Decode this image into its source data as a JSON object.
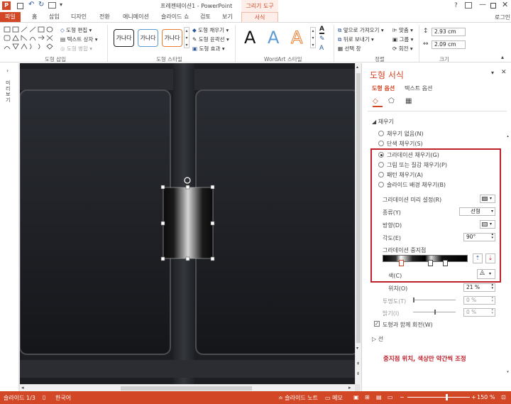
{
  "titlebar": {
    "title": "프레젠테이션1 - PowerPoint",
    "context_tool": "그리기 도구",
    "help": "?",
    "login": "로그인"
  },
  "tabs": [
    "파일",
    "홈",
    "삽입",
    "디자인",
    "전환",
    "애니메이션",
    "슬라이드 쇼",
    "검토",
    "보기",
    "서식"
  ],
  "ribbon": {
    "insert_shapes": {
      "edit": "도형 편집",
      "textbox": "텍스트 상자",
      "merge": "도형 병합",
      "label": "도형 삽입"
    },
    "shape_styles": {
      "samples": [
        "가나다",
        "가나다",
        "가나다"
      ],
      "fill": "도형 채우기",
      "outline": "도형 윤곽선",
      "effects": "도형 효과",
      "label": "도형 스타일"
    },
    "wordart": {
      "letters": [
        "A",
        "A",
        "A"
      ],
      "label": "WordArt 스타일"
    },
    "arrange": {
      "forward": "앞으로 가져오기",
      "backward": "뒤로 보내기",
      "selection": "선택 창",
      "align": "맞춤",
      "group": "그룹",
      "rotate": "회전",
      "label": "정렬"
    },
    "size": {
      "height": "2.93 cm",
      "width": "2.09 cm",
      "label": "크기"
    }
  },
  "left_strip": {
    "label": "미리보기"
  },
  "pane": {
    "title": "도형 서식",
    "tab_shape": "도형 옵션",
    "tab_text": "텍스트 옵션",
    "fill_section": "채우기",
    "fill_options": [
      {
        "label": "채우기 없음(N)",
        "checked": false
      },
      {
        "label": "단색 채우기(S)",
        "checked": false
      },
      {
        "label": "그라데이션 채우기(G)",
        "checked": true
      },
      {
        "label": "그림 또는 질감 채우기(P)",
        "checked": false
      },
      {
        "label": "패턴 채우기(A)",
        "checked": false
      },
      {
        "label": "슬라이드 배경 채우기(B)",
        "checked": false
      }
    ],
    "preset_label": "그라데이션 미리 설정(R)",
    "type_label": "종류(Y)",
    "type_value": "선형",
    "direction_label": "방향(D)",
    "angle_label": "각도(E)",
    "angle_value": "90°",
    "stops_label": "그라데이션 중지점",
    "color_label": "색(C)",
    "position_label": "위치(O)",
    "position_value": "21 %",
    "transparency_label": "투명도(T)",
    "transparency_value": "0 %",
    "brightness_label": "밝기(I)",
    "brightness_value": "0 %",
    "rotate_with_shape": "도형과 함께 회전(W)",
    "line_section": "선",
    "annotation": "중지점 위치, 색상만 약간씩 조정",
    "highlight_color": "#c0202a"
  },
  "status": {
    "slide": "슬라이드 1/3",
    "lang": "한국어",
    "notes": "슬라이드 노트",
    "comments": "메모",
    "zoom": "150 %"
  },
  "colors": {
    "accent": "#d24726",
    "slide_bg": "#1b1c20"
  }
}
